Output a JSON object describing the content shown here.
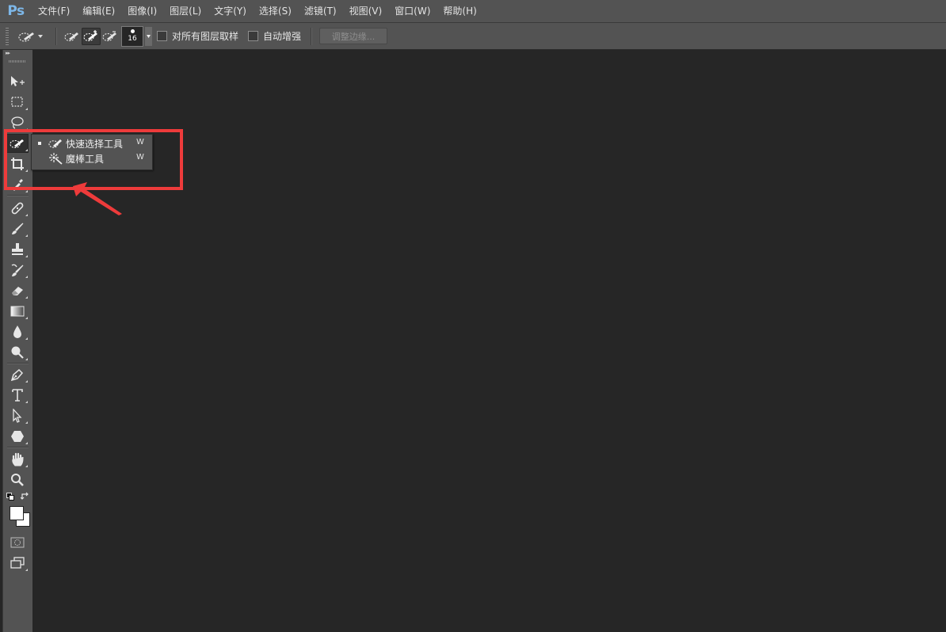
{
  "app": {
    "logo": "Ps"
  },
  "menu": [
    {
      "id": "file",
      "label": "文件(F)"
    },
    {
      "id": "edit",
      "label": "编辑(E)"
    },
    {
      "id": "image",
      "label": "图像(I)"
    },
    {
      "id": "layer",
      "label": "图层(L)"
    },
    {
      "id": "type",
      "label": "文字(Y)"
    },
    {
      "id": "select",
      "label": "选择(S)"
    },
    {
      "id": "filter",
      "label": "滤镜(T)"
    },
    {
      "id": "view",
      "label": "视图(V)"
    },
    {
      "id": "window",
      "label": "窗口(W)"
    },
    {
      "id": "help",
      "label": "帮助(H)"
    }
  ],
  "options": {
    "brush_size": "16",
    "sample_all_layers_label": "对所有图层取样",
    "sample_all_layers_checked": false,
    "auto_enhance_label": "自动增强",
    "auto_enhance_checked": false,
    "refine_edge_label": "调整边缘...",
    "refine_edge_enabled": false,
    "modes": [
      "new-selection-icon",
      "add-to-selection-icon",
      "subtract-from-selection-icon"
    ],
    "active_mode": "add-to-selection-icon"
  },
  "flyout": {
    "items": [
      {
        "label": "快速选择工具",
        "shortcut": "W",
        "icon": "quick-selection-icon",
        "active": true
      },
      {
        "label": "魔棒工具",
        "shortcut": "W",
        "icon": "magic-wand-icon",
        "active": false
      }
    ]
  },
  "colors": {
    "annotation": "#ee3b3b",
    "foreground": "#ffffff",
    "background": "#ffffff"
  }
}
